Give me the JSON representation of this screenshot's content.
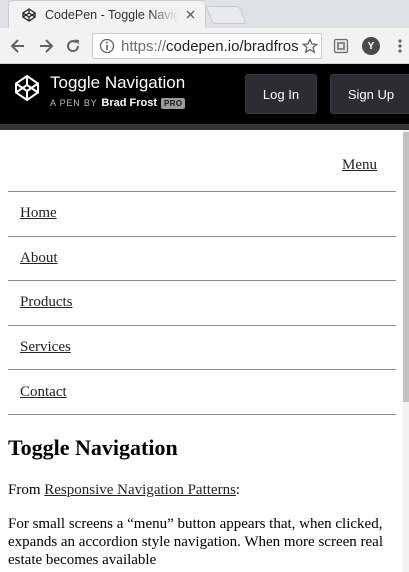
{
  "browser": {
    "tab_title": "CodePen - Toggle Navigation",
    "url_protocol": "https://",
    "url_rest": "codepen.io/bradfrost",
    "profile_initial": "Y"
  },
  "header": {
    "title": "Toggle Navigation",
    "byline_prefix": "A PEN BY",
    "author": "Brad Frost",
    "pro_badge": "PRO",
    "login_label": "Log In",
    "signup_label": "Sign Up"
  },
  "page": {
    "menu_label": "Menu",
    "nav_items": [
      "Home",
      "About",
      "Products",
      "Services",
      "Contact"
    ],
    "heading": "Toggle Navigation",
    "from_text": "From ",
    "source_link": "Responsive Navigation Patterns",
    "from_suffix": ":",
    "description": "For small screens a “menu” button appears that, when clicked, expands an accordion style navigation. When more screen real estate becomes available"
  },
  "colors": {
    "header_bg": "#000000",
    "header_button_bg": "#2c2d33",
    "chrome_bg": "#f2f2f2"
  }
}
